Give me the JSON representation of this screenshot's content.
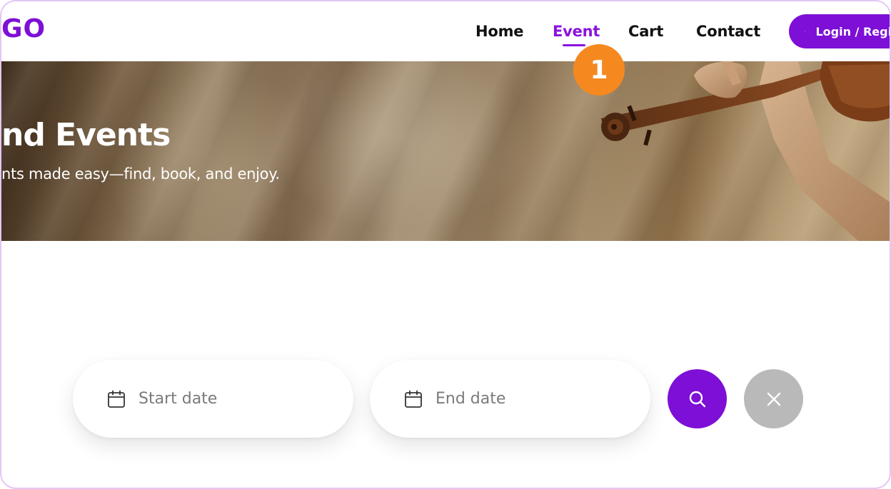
{
  "header": {
    "logo_text": "GO",
    "nav": [
      {
        "label": "Home"
      },
      {
        "label": "Event"
      },
      {
        "label": "Cart"
      },
      {
        "label": "Contact"
      }
    ],
    "login_label": "Login / Register",
    "active_nav": "Event"
  },
  "annotation": {
    "badge_number": "1"
  },
  "hero": {
    "title": "nd Events",
    "subtitle": "nts made easy—find, book, and enjoy."
  },
  "filter": {
    "start_placeholder": "Start date",
    "end_placeholder": "End date",
    "search_icon": "search-icon",
    "clear_icon": "close-icon",
    "calendar_icon": "calendar-icon"
  },
  "colors": {
    "brand": "#7d0fd6",
    "badge": "#f5891f",
    "clear_button": "#b9b9b9",
    "frame_border": "#e3c6f5"
  }
}
